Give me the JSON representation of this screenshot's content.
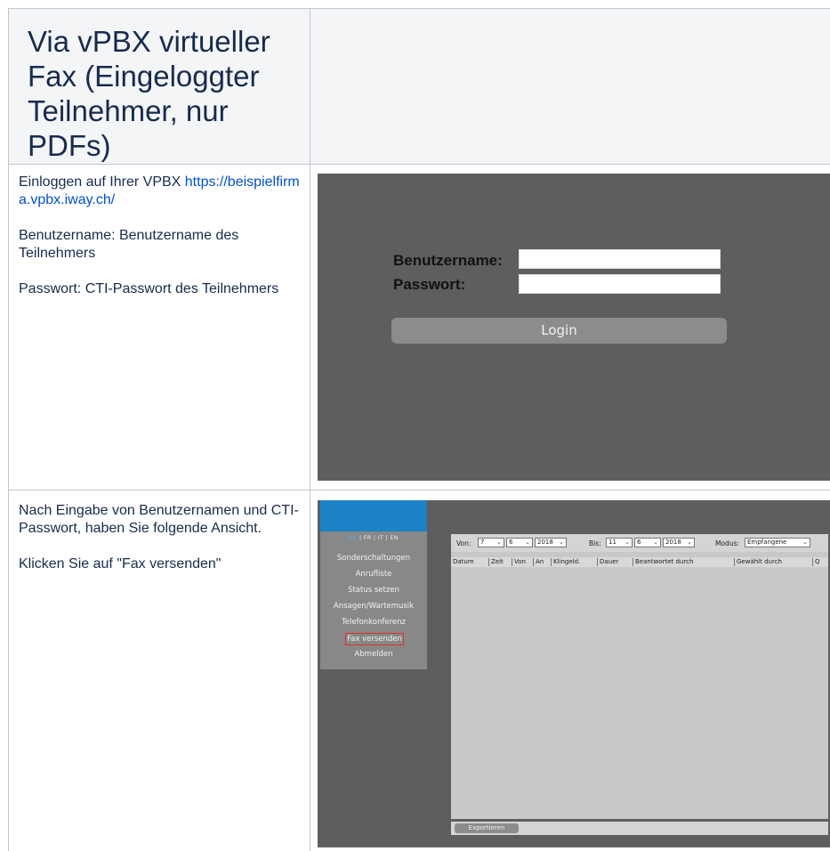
{
  "heading": "Via vPBX virtueller Fax (Eingeloggter Teilnehmer, nur PDFs)",
  "row1": {
    "intro_text": "Einloggen auf Ihrer VPBX ",
    "link_text": "https://beispielfirma.vpbx.iway.ch/",
    "username_text": "Benutzername: Benutzername des Teilnehmers",
    "password_text": "Passwort: CTI-Passwort des Teilnehmers"
  },
  "login_screen": {
    "username_label": "Benutzername:",
    "password_label": "Passwort:",
    "login_button": "Login"
  },
  "row2": {
    "text1": "Nach Eingabe von Benutzernamen und CTI-Passwort, haben Sie folgende Ansicht.",
    "text2": "Klicken Sie auf \"Fax versenden\""
  },
  "vpbx_screen": {
    "languages": {
      "de": "DE",
      "rest": " | FR | IT | EN"
    },
    "menu": [
      "Sonderschaltungen",
      "Anrufliste",
      "Status setzen",
      "Ansagen/Wartemusik",
      "Telefonkonferenz",
      "Fax versenden",
      "Abmelden"
    ],
    "filter": {
      "von_label": "Von:",
      "von_day": "7",
      "von_month": "6",
      "von_year": "2018",
      "bis_label": "Bis:",
      "bis_day": "11",
      "bis_month": "6",
      "bis_year": "2018",
      "modus_label": "Modus:",
      "modus_value": "Empfangene"
    },
    "columns": [
      "Datum",
      "Zeit",
      "Von",
      "An",
      "Klingeld.",
      "Dauer",
      "Beantwortet durch",
      "Gewählt durch",
      "Q"
    ],
    "export_button": "Exportieren"
  },
  "icons": {
    "dropdown": "chevron-down-icon"
  },
  "colors": {
    "link": "#0052cc",
    "header_bg": "#f4f5f7",
    "vpbx_blue": "#1a82c5",
    "highlight": "#e03030"
  }
}
